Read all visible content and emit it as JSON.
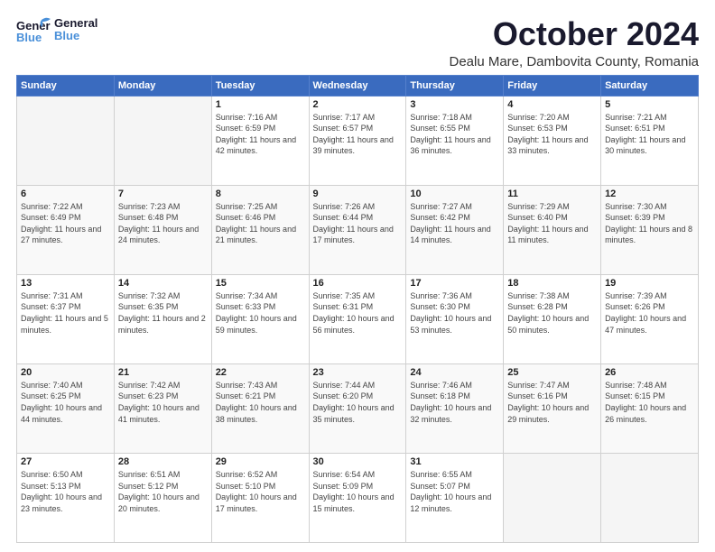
{
  "header": {
    "logo_general": "General",
    "logo_blue": "Blue",
    "month": "October 2024",
    "location": "Dealu Mare, Dambovita County, Romania"
  },
  "weekdays": [
    "Sunday",
    "Monday",
    "Tuesday",
    "Wednesday",
    "Thursday",
    "Friday",
    "Saturday"
  ],
  "weeks": [
    [
      {
        "day": "",
        "info": ""
      },
      {
        "day": "",
        "info": ""
      },
      {
        "day": "1",
        "sunrise": "Sunrise: 7:16 AM",
        "sunset": "Sunset: 6:59 PM",
        "daylight": "Daylight: 11 hours and 42 minutes."
      },
      {
        "day": "2",
        "sunrise": "Sunrise: 7:17 AM",
        "sunset": "Sunset: 6:57 PM",
        "daylight": "Daylight: 11 hours and 39 minutes."
      },
      {
        "day": "3",
        "sunrise": "Sunrise: 7:18 AM",
        "sunset": "Sunset: 6:55 PM",
        "daylight": "Daylight: 11 hours and 36 minutes."
      },
      {
        "day": "4",
        "sunrise": "Sunrise: 7:20 AM",
        "sunset": "Sunset: 6:53 PM",
        "daylight": "Daylight: 11 hours and 33 minutes."
      },
      {
        "day": "5",
        "sunrise": "Sunrise: 7:21 AM",
        "sunset": "Sunset: 6:51 PM",
        "daylight": "Daylight: 11 hours and 30 minutes."
      }
    ],
    [
      {
        "day": "6",
        "sunrise": "Sunrise: 7:22 AM",
        "sunset": "Sunset: 6:49 PM",
        "daylight": "Daylight: 11 hours and 27 minutes."
      },
      {
        "day": "7",
        "sunrise": "Sunrise: 7:23 AM",
        "sunset": "Sunset: 6:48 PM",
        "daylight": "Daylight: 11 hours and 24 minutes."
      },
      {
        "day": "8",
        "sunrise": "Sunrise: 7:25 AM",
        "sunset": "Sunset: 6:46 PM",
        "daylight": "Daylight: 11 hours and 21 minutes."
      },
      {
        "day": "9",
        "sunrise": "Sunrise: 7:26 AM",
        "sunset": "Sunset: 6:44 PM",
        "daylight": "Daylight: 11 hours and 17 minutes."
      },
      {
        "day": "10",
        "sunrise": "Sunrise: 7:27 AM",
        "sunset": "Sunset: 6:42 PM",
        "daylight": "Daylight: 11 hours and 14 minutes."
      },
      {
        "day": "11",
        "sunrise": "Sunrise: 7:29 AM",
        "sunset": "Sunset: 6:40 PM",
        "daylight": "Daylight: 11 hours and 11 minutes."
      },
      {
        "day": "12",
        "sunrise": "Sunrise: 7:30 AM",
        "sunset": "Sunset: 6:39 PM",
        "daylight": "Daylight: 11 hours and 8 minutes."
      }
    ],
    [
      {
        "day": "13",
        "sunrise": "Sunrise: 7:31 AM",
        "sunset": "Sunset: 6:37 PM",
        "daylight": "Daylight: 11 hours and 5 minutes."
      },
      {
        "day": "14",
        "sunrise": "Sunrise: 7:32 AM",
        "sunset": "Sunset: 6:35 PM",
        "daylight": "Daylight: 11 hours and 2 minutes."
      },
      {
        "day": "15",
        "sunrise": "Sunrise: 7:34 AM",
        "sunset": "Sunset: 6:33 PM",
        "daylight": "Daylight: 10 hours and 59 minutes."
      },
      {
        "day": "16",
        "sunrise": "Sunrise: 7:35 AM",
        "sunset": "Sunset: 6:31 PM",
        "daylight": "Daylight: 10 hours and 56 minutes."
      },
      {
        "day": "17",
        "sunrise": "Sunrise: 7:36 AM",
        "sunset": "Sunset: 6:30 PM",
        "daylight": "Daylight: 10 hours and 53 minutes."
      },
      {
        "day": "18",
        "sunrise": "Sunrise: 7:38 AM",
        "sunset": "Sunset: 6:28 PM",
        "daylight": "Daylight: 10 hours and 50 minutes."
      },
      {
        "day": "19",
        "sunrise": "Sunrise: 7:39 AM",
        "sunset": "Sunset: 6:26 PM",
        "daylight": "Daylight: 10 hours and 47 minutes."
      }
    ],
    [
      {
        "day": "20",
        "sunrise": "Sunrise: 7:40 AM",
        "sunset": "Sunset: 6:25 PM",
        "daylight": "Daylight: 10 hours and 44 minutes."
      },
      {
        "day": "21",
        "sunrise": "Sunrise: 7:42 AM",
        "sunset": "Sunset: 6:23 PM",
        "daylight": "Daylight: 10 hours and 41 minutes."
      },
      {
        "day": "22",
        "sunrise": "Sunrise: 7:43 AM",
        "sunset": "Sunset: 6:21 PM",
        "daylight": "Daylight: 10 hours and 38 minutes."
      },
      {
        "day": "23",
        "sunrise": "Sunrise: 7:44 AM",
        "sunset": "Sunset: 6:20 PM",
        "daylight": "Daylight: 10 hours and 35 minutes."
      },
      {
        "day": "24",
        "sunrise": "Sunrise: 7:46 AM",
        "sunset": "Sunset: 6:18 PM",
        "daylight": "Daylight: 10 hours and 32 minutes."
      },
      {
        "day": "25",
        "sunrise": "Sunrise: 7:47 AM",
        "sunset": "Sunset: 6:16 PM",
        "daylight": "Daylight: 10 hours and 29 minutes."
      },
      {
        "day": "26",
        "sunrise": "Sunrise: 7:48 AM",
        "sunset": "Sunset: 6:15 PM",
        "daylight": "Daylight: 10 hours and 26 minutes."
      }
    ],
    [
      {
        "day": "27",
        "sunrise": "Sunrise: 6:50 AM",
        "sunset": "Sunset: 5:13 PM",
        "daylight": "Daylight: 10 hours and 23 minutes."
      },
      {
        "day": "28",
        "sunrise": "Sunrise: 6:51 AM",
        "sunset": "Sunset: 5:12 PM",
        "daylight": "Daylight: 10 hours and 20 minutes."
      },
      {
        "day": "29",
        "sunrise": "Sunrise: 6:52 AM",
        "sunset": "Sunset: 5:10 PM",
        "daylight": "Daylight: 10 hours and 17 minutes."
      },
      {
        "day": "30",
        "sunrise": "Sunrise: 6:54 AM",
        "sunset": "Sunset: 5:09 PM",
        "daylight": "Daylight: 10 hours and 15 minutes."
      },
      {
        "day": "31",
        "sunrise": "Sunrise: 6:55 AM",
        "sunset": "Sunset: 5:07 PM",
        "daylight": "Daylight: 10 hours and 12 minutes."
      },
      {
        "day": "",
        "info": ""
      },
      {
        "day": "",
        "info": ""
      }
    ]
  ]
}
